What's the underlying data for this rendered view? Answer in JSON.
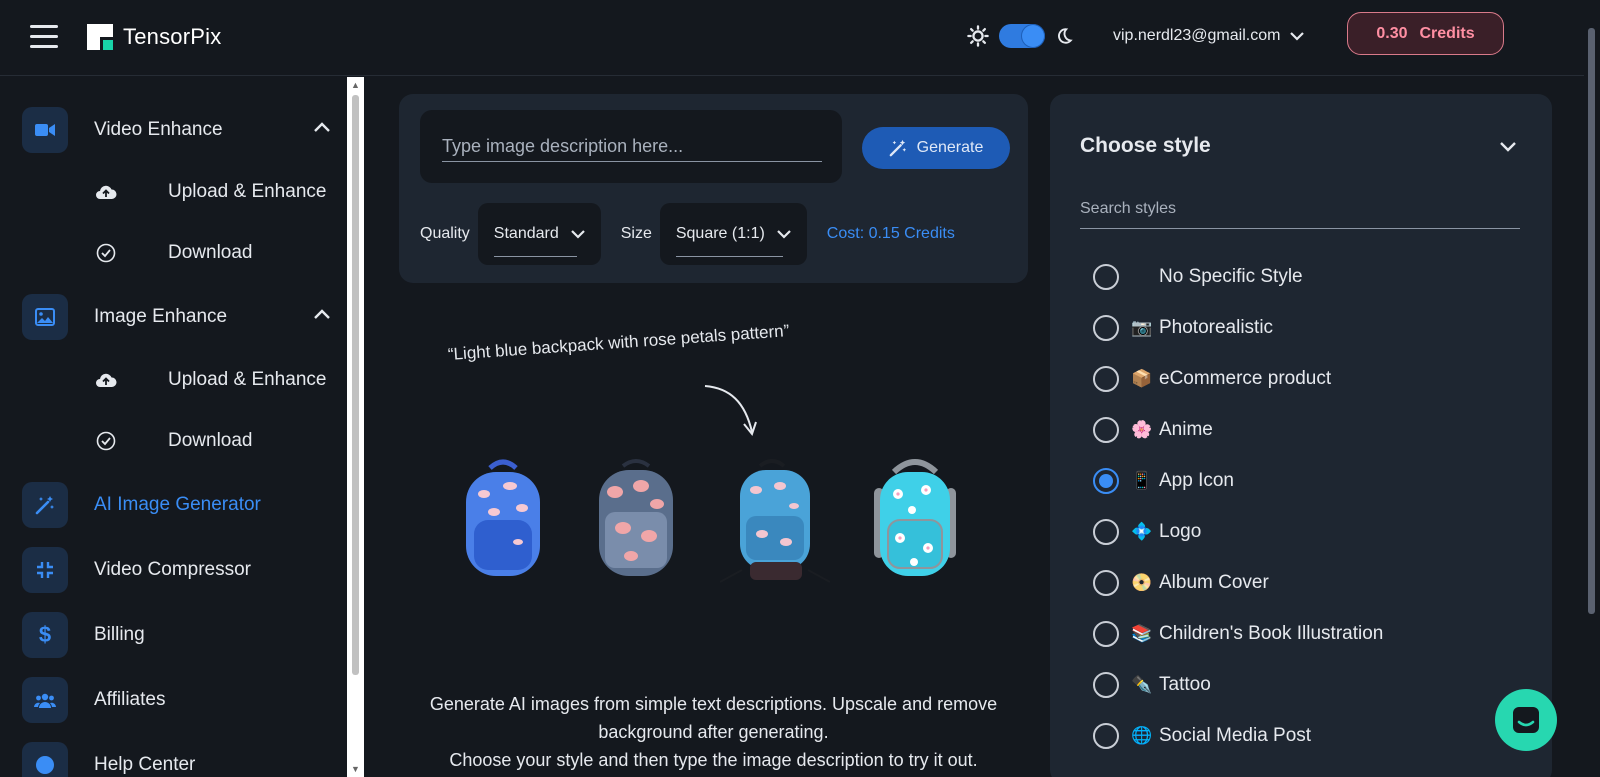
{
  "app": {
    "name": "TensorPix"
  },
  "header": {
    "account_email": "vip.nerdl23@gmail.com",
    "credits_value": "0.30",
    "credits_icon": "",
    "credits_label": "Credits"
  },
  "sidebar": {
    "video_enhance": {
      "label": "Video Enhance",
      "upload": "Upload & Enhance",
      "download": "Download"
    },
    "image_enhance": {
      "label": "Image Enhance",
      "upload": "Upload & Enhance",
      "download": "Download"
    },
    "ai_image_generator": "AI Image Generator",
    "video_compressor": "Video Compressor",
    "billing": "Billing",
    "affiliates": "Affiliates",
    "help_center": "Help Center"
  },
  "generator": {
    "prompt_placeholder": "Type image description here...",
    "generate_label": "Generate",
    "quality_label": "Quality",
    "quality_value": "Standard",
    "size_label": "Size",
    "size_value": "Square (1:1)",
    "cost": "Cost: 0.15 Credits",
    "example_quote": "“Light blue backpack with rose petals pattern”",
    "desc_line1": "Generate AI images from simple text descriptions. Upscale and remove background after generating.",
    "desc_line2": "Choose your style and then type the image description to try it out."
  },
  "styles": {
    "title": "Choose style",
    "search_placeholder": "Search styles",
    "items": [
      {
        "emoji": "",
        "label": "No Specific Style",
        "checked": false
      },
      {
        "emoji": "📷",
        "label": "Photorealistic",
        "checked": false
      },
      {
        "emoji": "📦",
        "label": "eCommerce product",
        "checked": false
      },
      {
        "emoji": "🌸",
        "label": "Anime",
        "checked": false
      },
      {
        "emoji": "📱",
        "label": "App Icon",
        "checked": true
      },
      {
        "emoji": "💠",
        "label": "Logo",
        "checked": false
      },
      {
        "emoji": "📀",
        "label": "Album Cover",
        "checked": false
      },
      {
        "emoji": "📚",
        "label": "Children's Book Illustration",
        "checked": false
      },
      {
        "emoji": "✒️",
        "label": "Tattoo",
        "checked": false
      },
      {
        "emoji": "🌐",
        "label": "Social Media Post",
        "checked": false
      }
    ]
  },
  "colors": {
    "accent": "#3a8df5",
    "panel": "#1e2631",
    "background": "#14181e",
    "chat": "#27d7b0",
    "credits": "#ff8fa3"
  }
}
